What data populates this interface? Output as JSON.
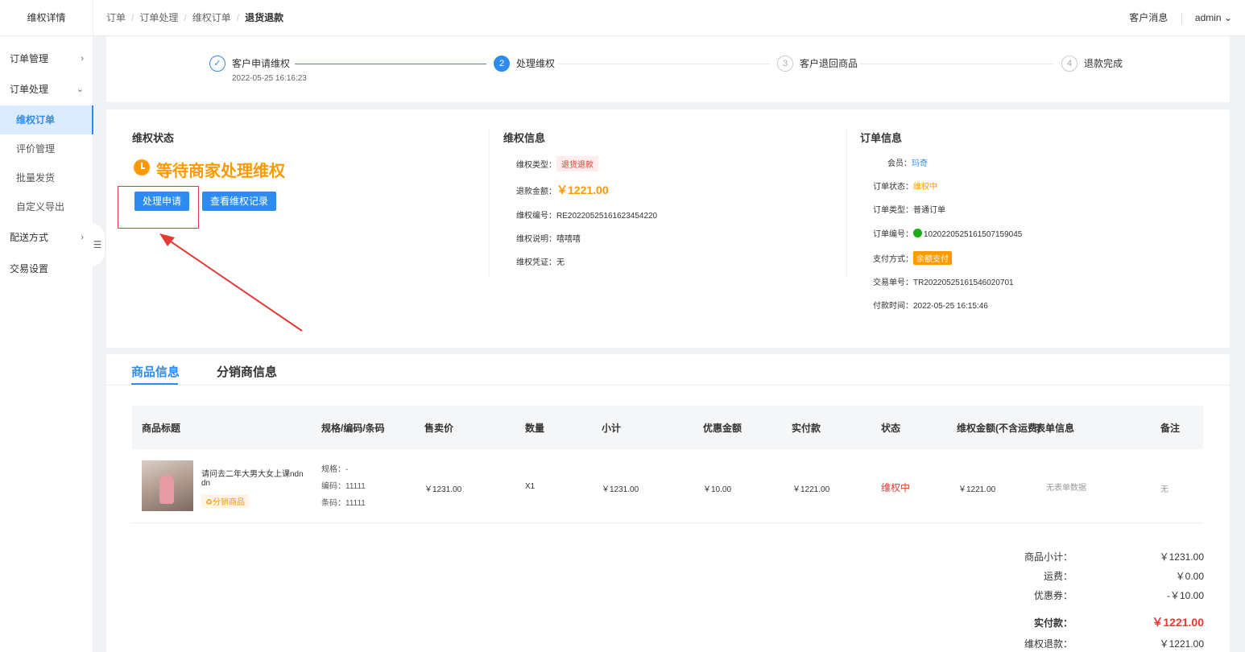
{
  "header": {
    "brand": "维权详情",
    "breadcrumb": [
      "订单",
      "订单处理",
      "维权订单",
      "退货退款"
    ],
    "messages": "客户消息",
    "user": "admin",
    "user_chevron": "⌄"
  },
  "sidebar": {
    "items": [
      {
        "label": "订单管理",
        "chevron": "›"
      },
      {
        "label": "订单处理",
        "chevron": "⌄"
      },
      {
        "label": "维权订单"
      },
      {
        "label": "评价管理"
      },
      {
        "label": "批量发货"
      },
      {
        "label": "自定义导出"
      },
      {
        "label": "配送方式",
        "chevron": "›"
      },
      {
        "label": "交易设置"
      }
    ],
    "collapse_icon": "☰"
  },
  "steps": [
    {
      "number": "✓",
      "title": "客户申请维权",
      "time": "2022-05-25 16:16:23",
      "state": "done"
    },
    {
      "number": "2",
      "title": "处理维权",
      "state": "active"
    },
    {
      "number": "3",
      "title": "客户退回商品",
      "state": "wait"
    },
    {
      "number": "4",
      "title": "退款完成",
      "state": "wait"
    }
  ],
  "status_section": {
    "title": "维权状态",
    "status": "等待商家处理维权",
    "process_button": "处理申请",
    "view_records_button": "查看维权记录"
  },
  "rights_info": {
    "title": "维权信息",
    "type_label": "维权类型：",
    "type_value": "退货退款",
    "amount_label": "退款金额：",
    "amount_value": "￥1221.00",
    "number_label": "维权编号：",
    "number_value": "RE20220525161623454220",
    "desc_label": "维权说明：",
    "desc_value": "嘻嘻嘻",
    "proof_label": "维权凭证：",
    "proof_value": "无"
  },
  "order_info": {
    "title": "订单信息",
    "member_label": "会员：",
    "member_value": "玛奇",
    "status_label": "订单状态：",
    "status_value": "维权中",
    "type_label": "订单类型：",
    "type_value": "普通订单",
    "number_label": "订单编号：",
    "number_value": "10202205251615071590​45",
    "pay_label": "支付方式：",
    "pay_value": "余额支付",
    "trade_label": "交易单号：",
    "trade_value": "TR20220525161546020701",
    "time_label": "付款时间：",
    "time_value": "2022-05-25 16:15:46"
  },
  "tabs": [
    "商品信息",
    "分销商信息"
  ],
  "table": {
    "headers": [
      "商品标题",
      "规格/编码/条码",
      "售卖价",
      "数量",
      "小计",
      "优惠金额",
      "实付款",
      "状态",
      "维权金额(不含运费)",
      "表单信息",
      "备注"
    ],
    "row": {
      "title_line1": "请问去二年大男大女上课ndn",
      "title_line2": "dn",
      "goods_tag": "分销商品",
      "spec": "规格：-",
      "code": "编码：11111",
      "barcode": "条码：11111",
      "price": "￥1231.00",
      "qty": "X1",
      "subtotal": "￥1231.00",
      "discount": "￥10.00",
      "paid": "￥1221.00",
      "status": "维权中",
      "refund": "￥1221.00",
      "form": "无表单数据",
      "remark": "无"
    }
  },
  "summary": {
    "goods_subtotal_label": "商品小计：",
    "goods_subtotal": "￥1231.00",
    "shipping_label": "运费：",
    "shipping": "￥0.00",
    "coupon_label": "优惠券：",
    "coupon": "-￥10.00",
    "paid_label": "实付款：",
    "paid": "￥1221.00",
    "refund_label": "维权退款：",
    "refund": "￥1221.00"
  },
  "colors": {
    "accent": "#2d8cf0",
    "warning": "#ff9900",
    "danger": "#e53935"
  }
}
